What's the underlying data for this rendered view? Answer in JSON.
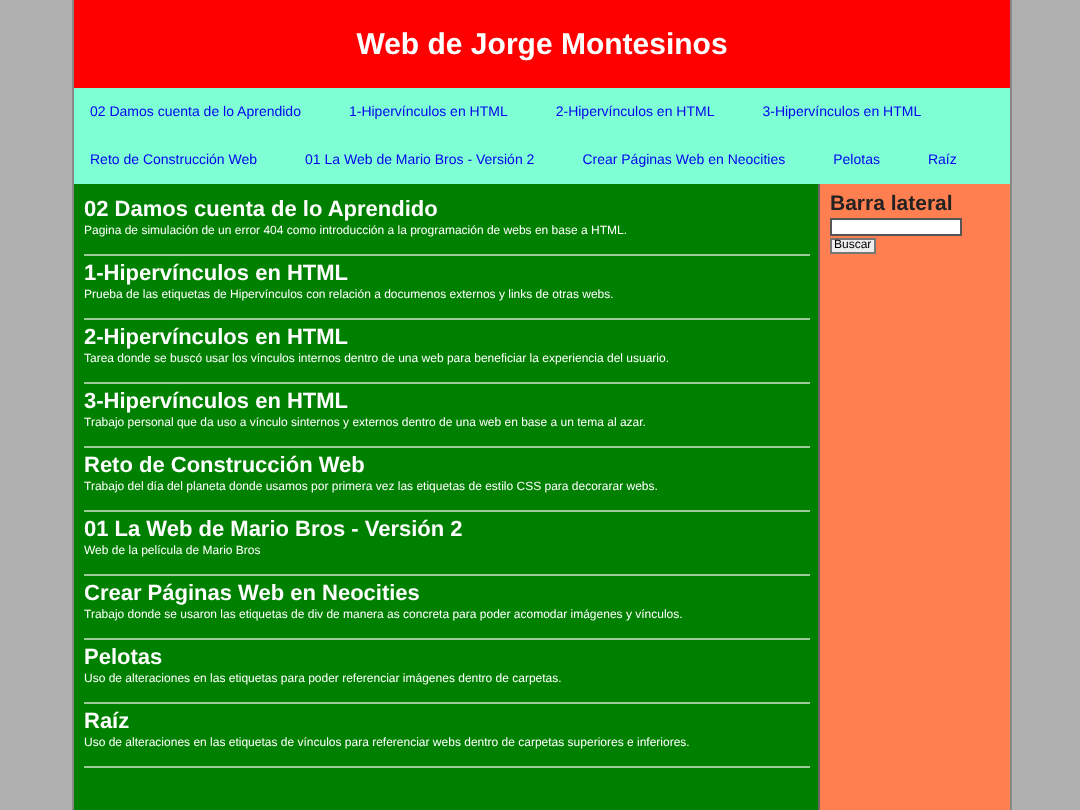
{
  "header": {
    "title": "Web de Jorge Montesinos"
  },
  "nav": [
    "02 Damos cuenta de lo Aprendido",
    "1-Hipervínculos en HTML",
    "2-Hipervínculos en HTML",
    "3-Hipervínculos en HTML",
    "Reto de Construcción Web",
    "01 La Web de Mario Bros - Versión 2",
    "Crear Páginas Web en Neocities",
    "Pelotas",
    "Raíz"
  ],
  "articles": [
    {
      "title": "02 Damos cuenta de lo Aprendido",
      "text": "Pagina de simulación de un error 404 como introducción a la programación de webs en base a HTML."
    },
    {
      "title": "1-Hipervínculos en HTML",
      "text": "Prueba de las etiquetas de Hipervínculos con relación a documenos externos y links de otras webs."
    },
    {
      "title": "2-Hipervínculos en HTML",
      "text": "Tarea donde se buscó usar los vínculos internos dentro de una web para beneficiar la experiencia del usuario."
    },
    {
      "title": "3-Hipervínculos en HTML",
      "text": "Trabajo personal que da uso a vínculo sinternos y externos dentro de una web en base a un tema al azar."
    },
    {
      "title": "Reto de Construcción Web",
      "text": "Trabajo del día del planeta donde usamos por primera vez las etiquetas de estilo CSS para decorarar webs."
    },
    {
      "title": "01 La Web de Mario Bros - Versión 2",
      "text": "Web de la película de Mario Bros"
    },
    {
      "title": "Crear Páginas Web en Neocities",
      "text": "Trabajo donde se usaron las etiquetas de div de manera as concreta para poder acomodar imágenes y vínculos."
    },
    {
      "title": "Pelotas",
      "text": "Uso de alteraciones en las etiquetas para poder referenciar imágenes dentro de carpetas."
    },
    {
      "title": "Raíz",
      "text": "Uso de alteraciones en las etiquetas de vínculos para referenciar webs dentro de carpetas superiores e inferiores."
    }
  ],
  "sidebar": {
    "title": "Barra lateral",
    "search_button": "Buscar"
  }
}
